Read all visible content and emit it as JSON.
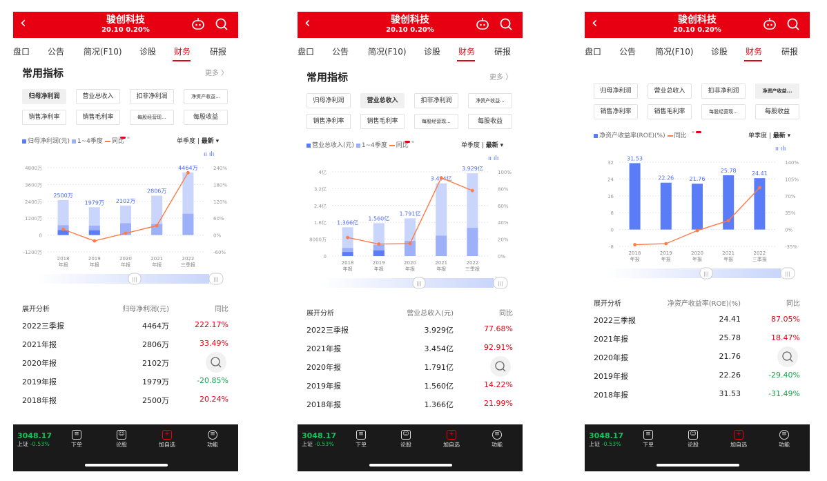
{
  "screens": [
    {
      "header": {
        "title": "骏创科技",
        "sub": "20.10 0.20%"
      },
      "tabs": [
        "盘口",
        "公告",
        "简况(F10)",
        "诊股",
        "财务",
        "研报"
      ],
      "active_tab": 4,
      "section_title": "常用指标",
      "more": "更多 〉",
      "chips_row1": [
        "归母净利润",
        "营业总收入",
        "扣非净利润",
        "净资产收益..."
      ],
      "chips_row2": [
        "销售净利率",
        "销售毛利率",
        "每股经营现...",
        "每股收益"
      ],
      "selected_chip": 0,
      "legend": {
        "bar": "归母净利润(元)",
        "bar2": "1~4季度",
        "line": "同比"
      },
      "quarter": {
        "a": "单季度",
        "b": "最新"
      },
      "table_header": [
        "展开分析",
        "归母净利润(元)",
        "同比"
      ],
      "rows": [
        {
          "period": "2022三季报",
          "value": "4464万",
          "yoy": "222.17%",
          "dir": "up"
        },
        {
          "period": "2021年报",
          "value": "2806万",
          "yoy": "33.49%",
          "dir": "up"
        },
        {
          "period": "2020年报",
          "value": "2102万",
          "yoy": "",
          "dir": "up"
        },
        {
          "period": "2019年报",
          "value": "1979万",
          "yoy": "-20.85%",
          "dir": "down"
        },
        {
          "period": "2018年报",
          "value": "2500万",
          "yoy": "20.24%",
          "dir": "up"
        }
      ],
      "chart_data": {
        "type": "bar",
        "categories": [
          "2018\n年报",
          "2019\n年报",
          "2020\n年报",
          "2021\n年报",
          "2022\n三季报"
        ],
        "left_ticks": [
          "4800万",
          "3600万",
          "2400万",
          "1200万",
          "0",
          "-1200万"
        ],
        "right_ticks": [
          "240%",
          "180%",
          "120%",
          "60%",
          "0%",
          "-60%"
        ],
        "ylim": [
          -1200,
          4800
        ],
        "y2lim": [
          -60,
          240
        ],
        "values": [
          2500,
          1979,
          2102,
          2806,
          4464
        ],
        "value_labels": [
          "2500万",
          "1979万",
          "2102万",
          "2806万",
          "4464万"
        ],
        "yoy": [
          20.24,
          -20.85,
          6.2,
          33.49,
          222.17
        ]
      }
    },
    {
      "header": {
        "title": "骏创科技",
        "sub": "20.10 0.20%"
      },
      "tabs": [
        "盘口",
        "公告",
        "简况(F10)",
        "诊股",
        "财务",
        "研报"
      ],
      "active_tab": 4,
      "section_title": "常用指标",
      "more": "更多 〉",
      "chips_row1": [
        "归母净利润",
        "营业总收入",
        "扣非净利润",
        "净资产收益..."
      ],
      "chips_row2": [
        "销售净利率",
        "销售毛利率",
        "每股经营现...",
        "每股收益"
      ],
      "selected_chip": 1,
      "legend": {
        "bar": "营业总收入(元)",
        "bar2": "1~4季度",
        "line": "同比"
      },
      "quarter": {
        "a": "单季度",
        "b": "最新"
      },
      "table_header": [
        "展开分析",
        "营业总收入(元)",
        "同比"
      ],
      "rows": [
        {
          "period": "2022三季报",
          "value": "3.929亿",
          "yoy": "77.68%",
          "dir": "up"
        },
        {
          "period": "2021年报",
          "value": "3.454亿",
          "yoy": "92.91%",
          "dir": "up"
        },
        {
          "period": "2020年报",
          "value": "1.791亿",
          "yoy": "",
          "dir": "up"
        },
        {
          "period": "2019年报",
          "value": "1.560亿",
          "yoy": "14.22%",
          "dir": "up"
        },
        {
          "period": "2018年报",
          "value": "1.366亿",
          "yoy": "21.99%",
          "dir": "up"
        }
      ],
      "chart_data": {
        "type": "bar",
        "categories": [
          "2018\n年报",
          "2019\n年报",
          "2020\n年报",
          "2021\n年报",
          "2022\n三季报"
        ],
        "left_ticks": [
          "4亿",
          "3.2亿",
          "2.4亿",
          "1.6亿",
          "8000万",
          "0"
        ],
        "right_ticks": [
          "100%",
          "80%",
          "60%",
          "40%",
          "20%",
          "0%"
        ],
        "ylim": [
          0,
          4
        ],
        "y2lim": [
          0,
          100
        ],
        "values": [
          1.366,
          1.56,
          1.791,
          3.454,
          3.929
        ],
        "value_labels": [
          "1.366亿",
          "1.560亿",
          "1.791亿",
          "3.454亿",
          "3.929亿"
        ],
        "yoy": [
          21.99,
          14.22,
          14.8,
          92.91,
          77.68
        ]
      }
    },
    {
      "header": {
        "title": "骏创科技",
        "sub": "20.10 0.20%"
      },
      "tabs": [
        "盘口",
        "公告",
        "简况(F10)",
        "诊股",
        "财务",
        "研报"
      ],
      "active_tab": 4,
      "section_title": "",
      "more": "",
      "chips_row1": [
        "归母净利润",
        "营业总收入",
        "扣非净利润",
        "净资产收益..."
      ],
      "chips_row2": [
        "销售净利率",
        "销售毛利率",
        "每股经营现...",
        "每股收益"
      ],
      "selected_chip": 3,
      "legend": {
        "bar": "净资产收益率(ROE)(%)",
        "bar2": "",
        "line": "同比"
      },
      "quarter": {
        "a": "单季度",
        "b": "最新"
      },
      "table_header": [
        "展开分析",
        "净资产收益率(ROE)(%)",
        "同比"
      ],
      "rows": [
        {
          "period": "2022三季报",
          "value": "24.41",
          "yoy": "87.05%",
          "dir": "up"
        },
        {
          "period": "2021年报",
          "value": "25.78",
          "yoy": "18.47%",
          "dir": "up"
        },
        {
          "period": "2020年报",
          "value": "21.76",
          "yoy": "",
          "dir": "up"
        },
        {
          "period": "2019年报",
          "value": "22.26",
          "yoy": "-29.40%",
          "dir": "down"
        },
        {
          "period": "2018年报",
          "value": "31.53",
          "yoy": "-31.49%",
          "dir": "down"
        }
      ],
      "chart_data": {
        "type": "bar",
        "categories": [
          "2018\n年报",
          "2019\n年报",
          "2020\n年报",
          "2021\n年报",
          "2022\n三季报"
        ],
        "left_ticks": [
          "32",
          "24",
          "16",
          "8",
          "0",
          "-8"
        ],
        "right_ticks": [
          "140%",
          "105%",
          "70%",
          "35%",
          "0%",
          "-35%"
        ],
        "ylim": [
          -8,
          32
        ],
        "y2lim": [
          -35,
          140
        ],
        "values": [
          31.53,
          22.26,
          21.76,
          25.78,
          24.41
        ],
        "value_labels": [
          "31.53",
          "22.26",
          "21.76",
          "25.78",
          "24.41"
        ],
        "yoy": [
          -31.49,
          -29.4,
          -2.2,
          18.47,
          87.05
        ]
      }
    }
  ],
  "footer": {
    "index": "3048.17",
    "name": "上证",
    "change": "-0.53%",
    "btns": [
      "下单",
      "论股",
      "加自选",
      "功能"
    ]
  },
  "colors": {
    "red": "#e60012",
    "bar": "#5b7cf7",
    "bar_light": "#c9d5fb",
    "line": "#ff7a45",
    "green": "#17a34a"
  }
}
